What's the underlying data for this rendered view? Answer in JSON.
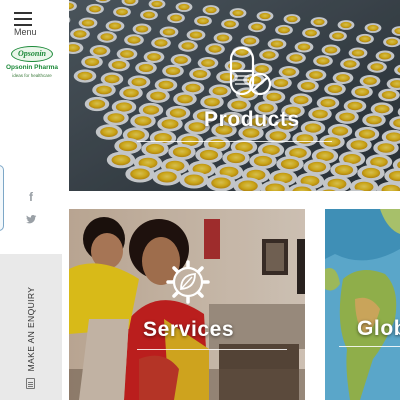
{
  "nav": {
    "menu_label": "Menu"
  },
  "brand": {
    "logo_text": "Opsonin",
    "name": "Opsonin Pharma",
    "tagline": "ideas for healthcare",
    "color": "#1d8a3a"
  },
  "social": {
    "facebook_icon": "f",
    "twitter_icon": "t"
  },
  "enquiry": {
    "label": "MAKE AN ENQUIRY"
  },
  "tiles": [
    {
      "id": "products",
      "title": "Products",
      "icon": "capsule-icon"
    },
    {
      "id": "services",
      "title": "Services",
      "icon": "gear-leaf-icon"
    },
    {
      "id": "global",
      "title": "Glob",
      "icon": "globe-map"
    }
  ],
  "colors": {
    "rail_bg": "#ffffff",
    "enquiry_bg": "#e9e9e9",
    "pill_yellow": "#f2c418",
    "social_grey": "#9aa0a6"
  }
}
